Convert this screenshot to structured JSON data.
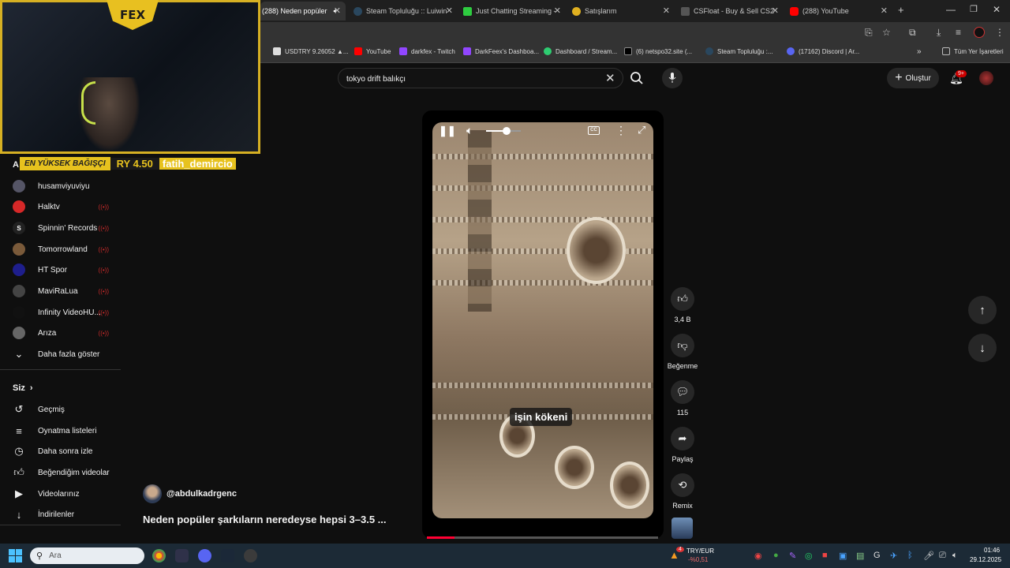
{
  "tabs": [
    {
      "label": "(288) Neden popüler",
      "active": true,
      "color": "#ff0000"
    },
    {
      "label": "Steam Topluluğu :: Luiwin",
      "active": false,
      "color": "#1b2838"
    },
    {
      "label": "Just Chatting Streaming -",
      "active": false,
      "color": "#2ecc40"
    },
    {
      "label": "Satışlarım",
      "active": false,
      "color": "#e0b020"
    },
    {
      "label": "CSFloat - Buy & Sell CS2",
      "active": false,
      "color": "#222"
    },
    {
      "label": "(288) YouTube",
      "active": false,
      "color": "#ff0000"
    }
  ],
  "bookmarks": [
    {
      "label": "USDTRY 9.26052 ▲...",
      "color": "#888"
    },
    {
      "label": "YouTube",
      "color": "#ff0000"
    },
    {
      "label": "darkfex - Twitch",
      "color": "#9146ff"
    },
    {
      "label": "DarkFeex's Dashboa...",
      "color": "#9146ff"
    },
    {
      "label": "Dashboard / Stream...",
      "color": "#2ecc71"
    },
    {
      "label": "(6) netspo32.site (...",
      "color": "#111"
    },
    {
      "label": "Steam Topluluğu :...",
      "color": "#1b2838"
    },
    {
      "label": "(17162) Discord | Ar...",
      "color": "#5865f2"
    },
    {
      "label": "Tüm Yer İşaretleri",
      "color": "#888"
    }
  ],
  "overlay": {
    "logo_text": "FEX",
    "donation_label": "EN YÜKSEK BAĞIŞÇI",
    "donation_amount": "RY 4.50",
    "donation_name": "fatih_demircio"
  },
  "sidebar": {
    "section_letter": "A",
    "subscriptions": [
      {
        "name": "husamviyuviyu",
        "live": false,
        "color": "#556"
      },
      {
        "name": "Halktv",
        "live": true,
        "color": "#d62828"
      },
      {
        "name": "Spinnin' Records",
        "live": true,
        "color": "#222"
      },
      {
        "name": "Tomorrowland",
        "live": true,
        "color": "#7a5a3a"
      },
      {
        "name": "HT Spor",
        "live": true,
        "color": "#1e1e8c"
      },
      {
        "name": "MaviRaLua",
        "live": true,
        "color": "#444"
      },
      {
        "name": "Infinity VideoHU...",
        "live": true,
        "color": "#111"
      },
      {
        "name": "Arıza",
        "live": true,
        "color": "#666"
      }
    ],
    "show_more": "Daha fazla göster",
    "you_title": "Siz",
    "you_items": [
      {
        "label": "Geçmiş",
        "icon": "history-icon",
        "glyph": "↺"
      },
      {
        "label": "Oynatma listeleri",
        "icon": "playlist-icon",
        "glyph": "≡"
      },
      {
        "label": "Daha sonra izle",
        "icon": "clock-icon",
        "glyph": "◷"
      },
      {
        "label": "Beğendiğim videolar",
        "icon": "thumbs-up-icon",
        "glyph": "👍︎"
      },
      {
        "label": "Videolarınız",
        "icon": "video-icon",
        "glyph": "▶"
      },
      {
        "label": "İndirilenler",
        "icon": "download-icon",
        "glyph": "↓"
      }
    ]
  },
  "search": {
    "value": "tokyo drift balıkçı"
  },
  "header": {
    "create_label": "Oluştur",
    "notif_badge": "9+"
  },
  "video": {
    "caption": "işin kökeni",
    "channel": "@abdulkadrgenc",
    "title": "Neden popüler şarkıların neredeyse hepsi 3–3.5 ...",
    "progress": 0.12,
    "volume": 0.6
  },
  "actions": {
    "likes": "3,4 B",
    "dislike": "Beğenme",
    "comments": "115",
    "share": "Paylaş",
    "remix": "Remix"
  },
  "taskbar": {
    "search_placeholder": "Ara",
    "currency_label": "TRY/EUR",
    "currency_change": "-%0,51",
    "currency_badge": "4",
    "time": "01:46",
    "date": "29.12.2025"
  }
}
